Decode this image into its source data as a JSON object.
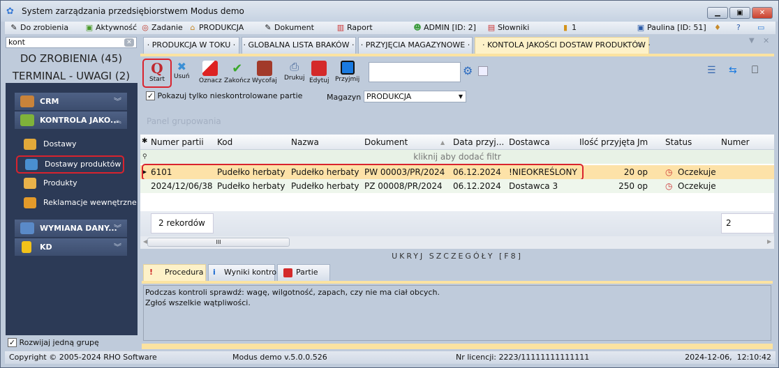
{
  "window": {
    "title": "System zarządzania przedsiębiorstwem Modus demo",
    "controls": [
      "minimize",
      "maximize",
      "close"
    ]
  },
  "menubar": [
    {
      "label": "Do zrobienia",
      "icon": "pencil-icon"
    },
    {
      "label": "Aktywność",
      "icon": "activity-icon"
    },
    {
      "label": "Zadanie",
      "icon": "task-icon"
    },
    {
      "label": "PRODUKCJA",
      "icon": "home-icon"
    },
    {
      "label": "Dokument",
      "icon": "pencil-icon"
    },
    {
      "label": "Raport",
      "icon": "chart-icon"
    },
    {
      "label": "ADMIN [ID: 2]",
      "icon": "user-icon"
    },
    {
      "label": "Słowniki",
      "icon": "calendar-icon"
    },
    {
      "label": "1",
      "icon": "database-icon"
    },
    {
      "label": "Paulina [ID: 51]",
      "icon": "computer-icon"
    }
  ],
  "sidebar": {
    "search_value": "kont",
    "todo": "DO ZROBIENIA (45)",
    "terminal": "TERMINAL - UWAGI (2)",
    "groups": [
      {
        "label": "CRM",
        "expanded": false
      },
      {
        "label": "KONTROLA JAKO...",
        "expanded": true,
        "items": [
          "Dostawy",
          "Dostawy produktów",
          "Produkty",
          "Reklamacje wewnętrzne"
        ]
      },
      {
        "label": "WYMIANA DANY...",
        "expanded": false
      },
      {
        "label": "KD",
        "expanded": false
      }
    ],
    "selected_item": "Dostawy produktów",
    "expand_one_label": "Rozwijaj jedną grupę",
    "expand_one_checked": true
  },
  "tabs": [
    {
      "label": "· PRODUKCJA W TOKU ·"
    },
    {
      "label": "· GLOBALNA LISTA BRAKÓW ·"
    },
    {
      "label": "· PRZYJĘCIA MAGAZYNOWE ·"
    },
    {
      "label": "· KONTOLA JAKOŚCI DOSTAW PRODUKTÓW ·",
      "active": true
    }
  ],
  "toolbar": {
    "buttons": [
      "Start",
      "Usuń",
      "Oznacz",
      "Zakończ",
      "Wycofaj",
      "Drukuj",
      "Edytuj",
      "Przyjmij"
    ],
    "search_value": ""
  },
  "filters": {
    "only_unchecked_label": "Pokazuj tylko nieskontrolowane partie",
    "only_unchecked": true,
    "warehouse_label": "Magazyn",
    "warehouse_value": "PRODUKCJA"
  },
  "group_panel": "Panel grupowania",
  "grid": {
    "columns": [
      "Numer partii",
      "Kod",
      "Nazwa",
      "Dokument",
      "Data przyj...",
      "Dostawca",
      "Ilość przyjęta",
      "Jm",
      "Status",
      "Numer"
    ],
    "filter_hint": "kliknij aby dodać filtr",
    "rows": [
      [
        "6101",
        "Pudełko herbaty",
        "Pudełko herbaty",
        "PW 00003/PR/2024",
        "06.12.2024",
        "!NIEOKREŚLONY",
        "20",
        "op",
        "Oczekuje"
      ],
      [
        "2024/12/06/38",
        "Pudełko herbaty",
        "Pudełko herbaty",
        "PZ 00008/PR/2024",
        "06.12.2024",
        "Dostawca 3",
        "250",
        "op",
        "Oczekuje"
      ]
    ],
    "record_count": "2 rekordów",
    "sum_value": "2"
  },
  "details": {
    "toggle_label": "UKRYJ SZCZEGÓŁY [F8]",
    "tabs": [
      "Procedura",
      "Wyniki kontroli",
      "Partie"
    ],
    "text_lines": [
      "Podczas kontroli sprawdź: wagę, wilgotność, zapach, czy nie ma ciał obcych.",
      "Zgłoś wszelkie wątpliwości."
    ]
  },
  "statusbar": {
    "copyright": "Copyright © 2005-2024 RHO Software",
    "version": "Modus demo v.5.0.0.526",
    "license": "Nr licencji: 2223/11111111111111",
    "datetime": "2024-12-06,  12:10:42"
  },
  "colors": {
    "nav_bg": "#2c3a56",
    "highlight": "#d9232e",
    "selected_row": "#fde2a8",
    "active_tab": "#fdf1c8"
  }
}
